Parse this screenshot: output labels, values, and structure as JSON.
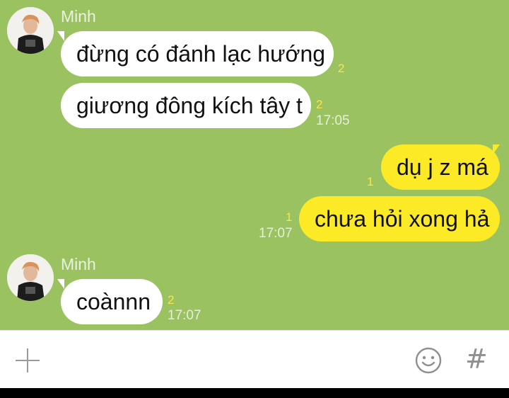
{
  "chat": {
    "groups": [
      {
        "sender": "Minh",
        "messages": [
          {
            "text": "đừng có đánh lạc hướng",
            "read_count": "2",
            "time": ""
          },
          {
            "text": "giương đông kích tây t",
            "read_count": "2",
            "time": "17:05"
          }
        ]
      },
      {
        "sender": "",
        "messages": [
          {
            "text": "dụ j z má",
            "read_count": "1",
            "time": ""
          },
          {
            "text": "chưa hỏi xong hả",
            "read_count": "1",
            "time": "17:07"
          }
        ]
      },
      {
        "sender": "Minh",
        "messages": [
          {
            "text": "coànnn",
            "read_count": "2",
            "time": "17:07"
          }
        ]
      }
    ]
  },
  "input_bar": {
    "icons": [
      "plus-icon",
      "emoji-icon",
      "hashtag-icon"
    ],
    "hash_glyph": "#"
  },
  "colors": {
    "background": "#9bc260",
    "incoming_bubble": "#ffffff",
    "outgoing_bubble": "#fbea25",
    "read_count": "#f7e64d"
  }
}
